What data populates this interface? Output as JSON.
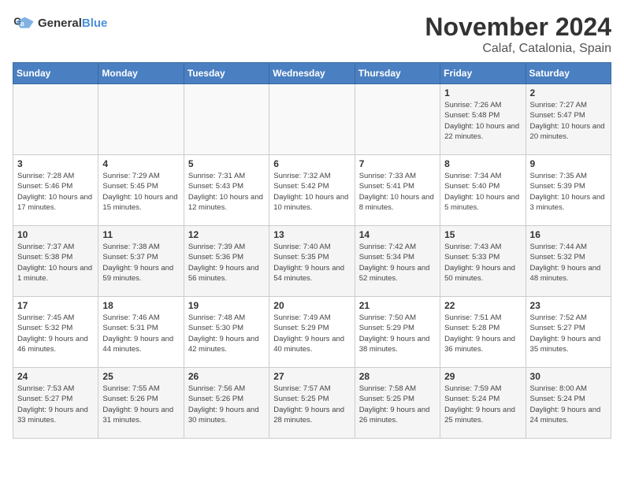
{
  "logo": {
    "text_general": "General",
    "text_blue": "Blue"
  },
  "title": "November 2024",
  "location": "Calaf, Catalonia, Spain",
  "weekdays": [
    "Sunday",
    "Monday",
    "Tuesday",
    "Wednesday",
    "Thursday",
    "Friday",
    "Saturday"
  ],
  "weeks": [
    [
      {
        "day": "",
        "info": ""
      },
      {
        "day": "",
        "info": ""
      },
      {
        "day": "",
        "info": ""
      },
      {
        "day": "",
        "info": ""
      },
      {
        "day": "",
        "info": ""
      },
      {
        "day": "1",
        "info": "Sunrise: 7:26 AM\nSunset: 5:48 PM\nDaylight: 10 hours and 22 minutes."
      },
      {
        "day": "2",
        "info": "Sunrise: 7:27 AM\nSunset: 5:47 PM\nDaylight: 10 hours and 20 minutes."
      }
    ],
    [
      {
        "day": "3",
        "info": "Sunrise: 7:28 AM\nSunset: 5:46 PM\nDaylight: 10 hours and 17 minutes."
      },
      {
        "day": "4",
        "info": "Sunrise: 7:29 AM\nSunset: 5:45 PM\nDaylight: 10 hours and 15 minutes."
      },
      {
        "day": "5",
        "info": "Sunrise: 7:31 AM\nSunset: 5:43 PM\nDaylight: 10 hours and 12 minutes."
      },
      {
        "day": "6",
        "info": "Sunrise: 7:32 AM\nSunset: 5:42 PM\nDaylight: 10 hours and 10 minutes."
      },
      {
        "day": "7",
        "info": "Sunrise: 7:33 AM\nSunset: 5:41 PM\nDaylight: 10 hours and 8 minutes."
      },
      {
        "day": "8",
        "info": "Sunrise: 7:34 AM\nSunset: 5:40 PM\nDaylight: 10 hours and 5 minutes."
      },
      {
        "day": "9",
        "info": "Sunrise: 7:35 AM\nSunset: 5:39 PM\nDaylight: 10 hours and 3 minutes."
      }
    ],
    [
      {
        "day": "10",
        "info": "Sunrise: 7:37 AM\nSunset: 5:38 PM\nDaylight: 10 hours and 1 minute."
      },
      {
        "day": "11",
        "info": "Sunrise: 7:38 AM\nSunset: 5:37 PM\nDaylight: 9 hours and 59 minutes."
      },
      {
        "day": "12",
        "info": "Sunrise: 7:39 AM\nSunset: 5:36 PM\nDaylight: 9 hours and 56 minutes."
      },
      {
        "day": "13",
        "info": "Sunrise: 7:40 AM\nSunset: 5:35 PM\nDaylight: 9 hours and 54 minutes."
      },
      {
        "day": "14",
        "info": "Sunrise: 7:42 AM\nSunset: 5:34 PM\nDaylight: 9 hours and 52 minutes."
      },
      {
        "day": "15",
        "info": "Sunrise: 7:43 AM\nSunset: 5:33 PM\nDaylight: 9 hours and 50 minutes."
      },
      {
        "day": "16",
        "info": "Sunrise: 7:44 AM\nSunset: 5:32 PM\nDaylight: 9 hours and 48 minutes."
      }
    ],
    [
      {
        "day": "17",
        "info": "Sunrise: 7:45 AM\nSunset: 5:32 PM\nDaylight: 9 hours and 46 minutes."
      },
      {
        "day": "18",
        "info": "Sunrise: 7:46 AM\nSunset: 5:31 PM\nDaylight: 9 hours and 44 minutes."
      },
      {
        "day": "19",
        "info": "Sunrise: 7:48 AM\nSunset: 5:30 PM\nDaylight: 9 hours and 42 minutes."
      },
      {
        "day": "20",
        "info": "Sunrise: 7:49 AM\nSunset: 5:29 PM\nDaylight: 9 hours and 40 minutes."
      },
      {
        "day": "21",
        "info": "Sunrise: 7:50 AM\nSunset: 5:29 PM\nDaylight: 9 hours and 38 minutes."
      },
      {
        "day": "22",
        "info": "Sunrise: 7:51 AM\nSunset: 5:28 PM\nDaylight: 9 hours and 36 minutes."
      },
      {
        "day": "23",
        "info": "Sunrise: 7:52 AM\nSunset: 5:27 PM\nDaylight: 9 hours and 35 minutes."
      }
    ],
    [
      {
        "day": "24",
        "info": "Sunrise: 7:53 AM\nSunset: 5:27 PM\nDaylight: 9 hours and 33 minutes."
      },
      {
        "day": "25",
        "info": "Sunrise: 7:55 AM\nSunset: 5:26 PM\nDaylight: 9 hours and 31 minutes."
      },
      {
        "day": "26",
        "info": "Sunrise: 7:56 AM\nSunset: 5:26 PM\nDaylight: 9 hours and 30 minutes."
      },
      {
        "day": "27",
        "info": "Sunrise: 7:57 AM\nSunset: 5:25 PM\nDaylight: 9 hours and 28 minutes."
      },
      {
        "day": "28",
        "info": "Sunrise: 7:58 AM\nSunset: 5:25 PM\nDaylight: 9 hours and 26 minutes."
      },
      {
        "day": "29",
        "info": "Sunrise: 7:59 AM\nSunset: 5:24 PM\nDaylight: 9 hours and 25 minutes."
      },
      {
        "day": "30",
        "info": "Sunrise: 8:00 AM\nSunset: 5:24 PM\nDaylight: 9 hours and 24 minutes."
      }
    ]
  ]
}
